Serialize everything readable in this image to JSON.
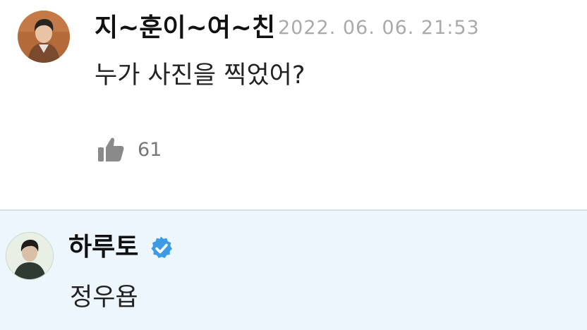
{
  "comment": {
    "author": "지~훈이~여~친",
    "timestamp": "2022. 06. 06. 21:53",
    "text": "누가 사진을 찍었어?",
    "like_icon": "thumbs-up-icon",
    "like_count": "61"
  },
  "reply": {
    "author": "하루토",
    "verified_icon": "verified-badge-icon",
    "text": "정우욥"
  },
  "colors": {
    "reply_background": "#edf6fd",
    "verified_badge": "#3c9be6",
    "divider": "#d7e1ea"
  }
}
